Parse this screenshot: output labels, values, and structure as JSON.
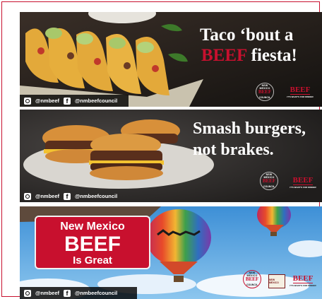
{
  "panels": [
    {
      "headline_line1": "Taco ‘bout a",
      "headline_accent": "BEEF",
      "headline_rest": " fiesta!",
      "social_instagram": "@nmbeef",
      "social_facebook": "@nmbeefcouncil"
    },
    {
      "headline_line1": "Smash burgers,",
      "headline_line2": "not brakes.",
      "social_instagram": "@nmbeef",
      "social_facebook": "@nmbeefcouncil"
    },
    {
      "plate_line1": "New Mexico",
      "plate_line2": "BEEF",
      "plate_line3": "Is Great",
      "social_instagram": "@nmbeef",
      "social_facebook": "@nmbeefcouncil"
    }
  ],
  "logos": {
    "council_top": "NEW MEXICO",
    "council_mid": "BEEF",
    "council_bottom": "COUNCIL",
    "beef_word": "BEEF",
    "beef_tagline": "IT'S WHAT'S FOR DINNER",
    "nm_state_label": "NEW MEXICO"
  },
  "colors": {
    "accent_red": "#c8102e",
    "plate_red": "#c8102e",
    "sky_blue": "#5aa6e0"
  },
  "icons": [
    "instagram-icon",
    "facebook-icon"
  ]
}
